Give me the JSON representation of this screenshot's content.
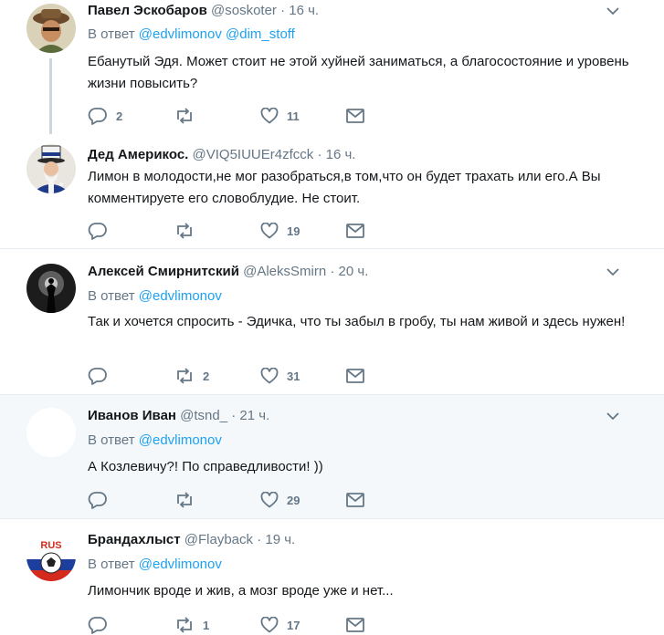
{
  "colors": {
    "link": "#1da1f2",
    "muted": "#657786",
    "icon": "#657786",
    "highlight_bg": "#f5f8fa"
  },
  "tweets": [
    {
      "name": "Павел Эскобаров",
      "handle": "@soskoter",
      "dot": "·",
      "time": "16 ч.",
      "reply_prefix": "В ответ",
      "mentions": [
        "@edvlimonov",
        "@dim_stoff"
      ],
      "text": "Ебанутый Эдя. Может стоит не этой хуйней заниматься, а благосостояние и уровень жизни повысить?",
      "replies": "2",
      "retweets": "",
      "likes": "11",
      "avatar_icon": "person-with-hat-icon"
    },
    {
      "name": "Дед Америкос.",
      "handle": "@VIQ5IUUEr4zfcck",
      "dot": "·",
      "time": "16 ч.",
      "text": "Лимон в молодости,не мог разобраться,в том,что он будет трахать или его.А Вы комментируете  его словоблудие. Не стоит.",
      "replies": "",
      "retweets": "",
      "likes": "19",
      "avatar_icon": "uncle-sam-icon"
    },
    {
      "name": "Алексей Смирнитский",
      "handle": "@AleksSmirn",
      "dot": "·",
      "time": "20 ч.",
      "reply_prefix": "В ответ",
      "mentions": [
        "@edvlimonov"
      ],
      "text": "Так и хочется спросить - Эдичка, что ты забыл в гробу, ты нам живой и здесь нужен!",
      "replies": "",
      "retweets": "2",
      "likes": "31",
      "avatar_icon": "silhouette-photo-icon"
    },
    {
      "name": "Иванов Иван",
      "handle": "@tsnd_",
      "dot": "·",
      "time": "21 ч.",
      "reply_prefix": "В ответ",
      "mentions": [
        "@edvlimonov"
      ],
      "text": "А Козлевичу?! По справедливости! ))",
      "replies": "",
      "retweets": "",
      "likes": "29",
      "avatar_icon": "blank-avatar-icon"
    },
    {
      "name": "Брандахлыст",
      "handle": "@Flayback",
      "dot": "·",
      "time": "19 ч.",
      "reply_prefix": "В ответ",
      "mentions": [
        "@edvlimonov"
      ],
      "text": "Лимончик вроде и жив, а мозг вроде уже и нет...",
      "replies": "",
      "retweets": "1",
      "likes": "17",
      "avatar_icon": "rus-flag-football-icon",
      "avatar_text": "RUS"
    }
  ]
}
